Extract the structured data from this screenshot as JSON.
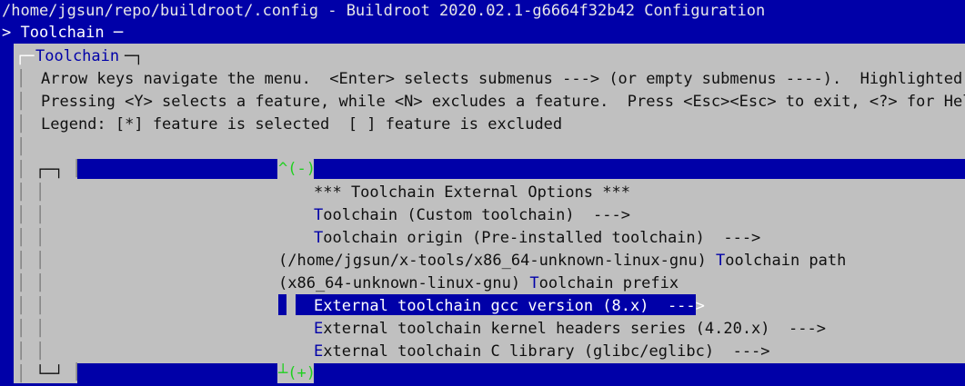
{
  "window": {
    "title": "/home/jgsun/repo/buildroot/.config - Buildroot 2020.02.1-g6664f32b42 Configuration",
    "breadcrumb_prefix": ">",
    "breadcrumb": "Toolchain",
    "breadcrumb_suffix": "─"
  },
  "dialog": {
    "title": "Toolchain",
    "help_lines": [
      "Arrow keys navigate the menu.  <Enter> selects submenus ---> (or empty submenus ----).  Highlighted le",
      "Pressing <Y> selects a feature, while <N> excludes a feature.  Press <Esc><Esc> to exit, <?> for Help,",
      "Legend: [*] feature is selected  [ ] feature is excluded"
    ],
    "scroll_up": "^(-)",
    "scroll_down": "(+)",
    "items": [
      {
        "hotkey": "",
        "text": "*** Toolchain External Options ***"
      },
      {
        "hotkey": "T",
        "text": "oolchain (Custom toolchain)  --->"
      },
      {
        "hotkey": "T",
        "text": "oolchain origin (Pre-installed toolchain)  --->"
      },
      {
        "pre": "(/home/jgsun/x-tools/x86_64-unknown-linux-gnu) ",
        "hotkey": "T",
        "text": "oolchain path"
      },
      {
        "pre": "(x86_64-unknown-linux-gnu) ",
        "hotkey": "T",
        "text": "oolchain prefix"
      },
      {
        "hotkey": "E",
        "text": "xternal toolchain gcc version (8.x)  --->",
        "selected": true
      },
      {
        "hotkey": "E",
        "text": "xternal toolchain kernel headers series (4.20.x)  --->"
      },
      {
        "hotkey": "E",
        "text": "xternal toolchain C library (glibc/eglibc)  --->"
      }
    ]
  },
  "colors": {
    "background": "#0000a8",
    "dialog": "#c0c0c0",
    "highlight_text": "#0000a8",
    "scroll_arrow": "#20d020"
  }
}
